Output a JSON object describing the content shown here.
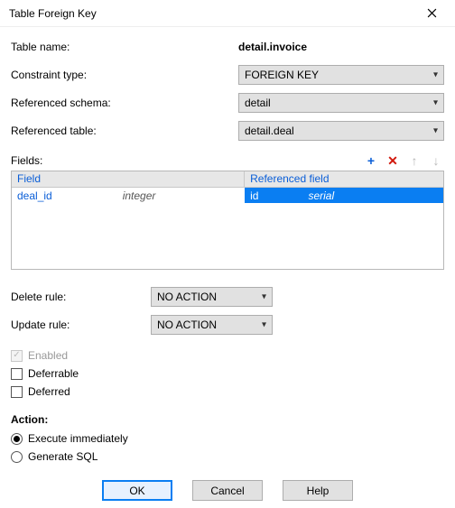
{
  "window": {
    "title": "Table Foreign Key"
  },
  "labels": {
    "table_name": "Table name:",
    "constraint_type": "Constraint type:",
    "ref_schema": "Referenced schema:",
    "ref_table": "Referenced table:",
    "fields": "Fields:",
    "delete_rule": "Delete rule:",
    "update_rule": "Update rule:",
    "enabled": "Enabled",
    "deferrable": "Deferrable",
    "deferred": "Deferred",
    "action": "Action:",
    "execute_immediately": "Execute immediately",
    "generate_sql": "Generate SQL"
  },
  "values": {
    "table_name": "detail.invoice",
    "constraint_type": "FOREIGN KEY",
    "ref_schema": "detail",
    "ref_table": "detail.deal",
    "delete_rule": "NO ACTION",
    "update_rule": "NO ACTION"
  },
  "grid": {
    "headers": {
      "field": "Field",
      "referenced": "Referenced field"
    },
    "rows": [
      {
        "field": "deal_id",
        "field_type": "integer",
        "ref": "id",
        "ref_type": "serial"
      }
    ]
  },
  "buttons": {
    "ok": "OK",
    "cancel": "Cancel",
    "help": "Help"
  }
}
